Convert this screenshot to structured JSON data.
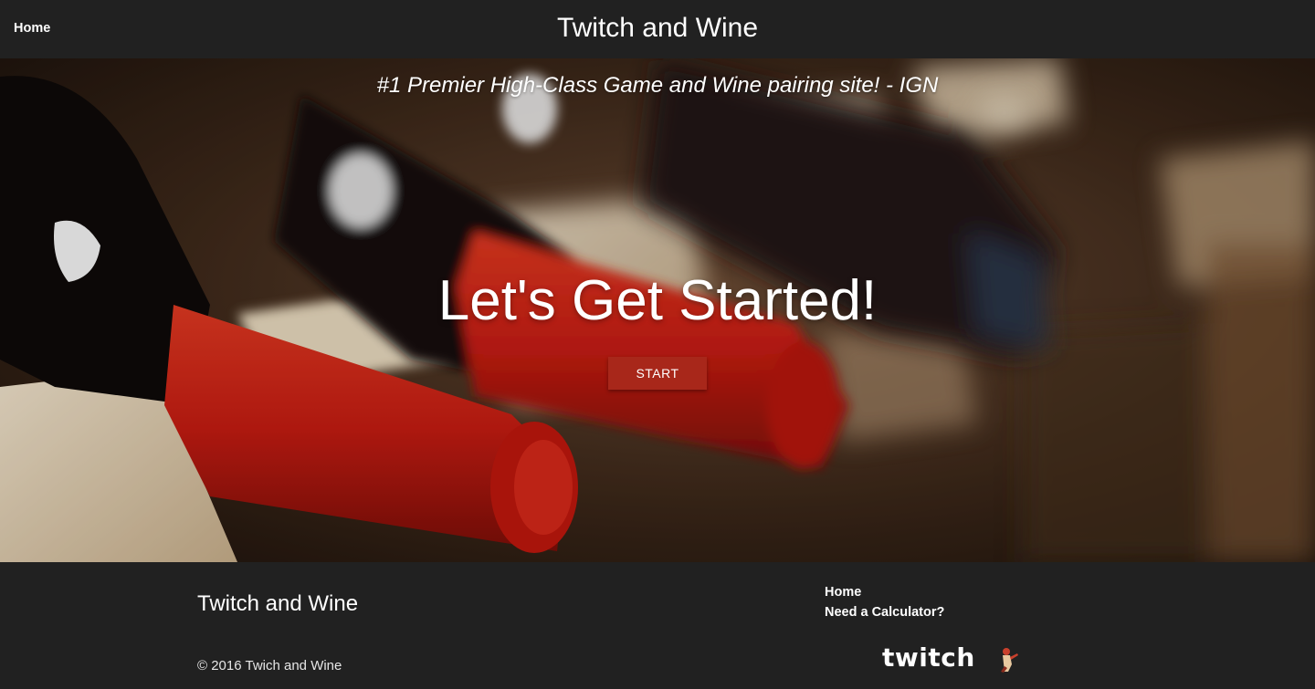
{
  "nav": {
    "home_label": "Home",
    "brand": "Twitch and Wine"
  },
  "hero": {
    "tagline": "#1 Premier High-Class Game and Wine pairing site! - IGN",
    "headline": "Let's Get Started!",
    "start_label": "START"
  },
  "footer": {
    "title": "Twitch and Wine",
    "links": [
      "Home",
      "Need a Calculator?"
    ],
    "copyright": "© 2016 Twich and Wine",
    "logo_text": "twitch"
  },
  "colors": {
    "bar_bg": "#212121",
    "button_red": "#a8271a",
    "text": "#ffffff"
  },
  "icons": {
    "logo": "twitch-logo",
    "mascot": "twitch-mascot-icon"
  }
}
